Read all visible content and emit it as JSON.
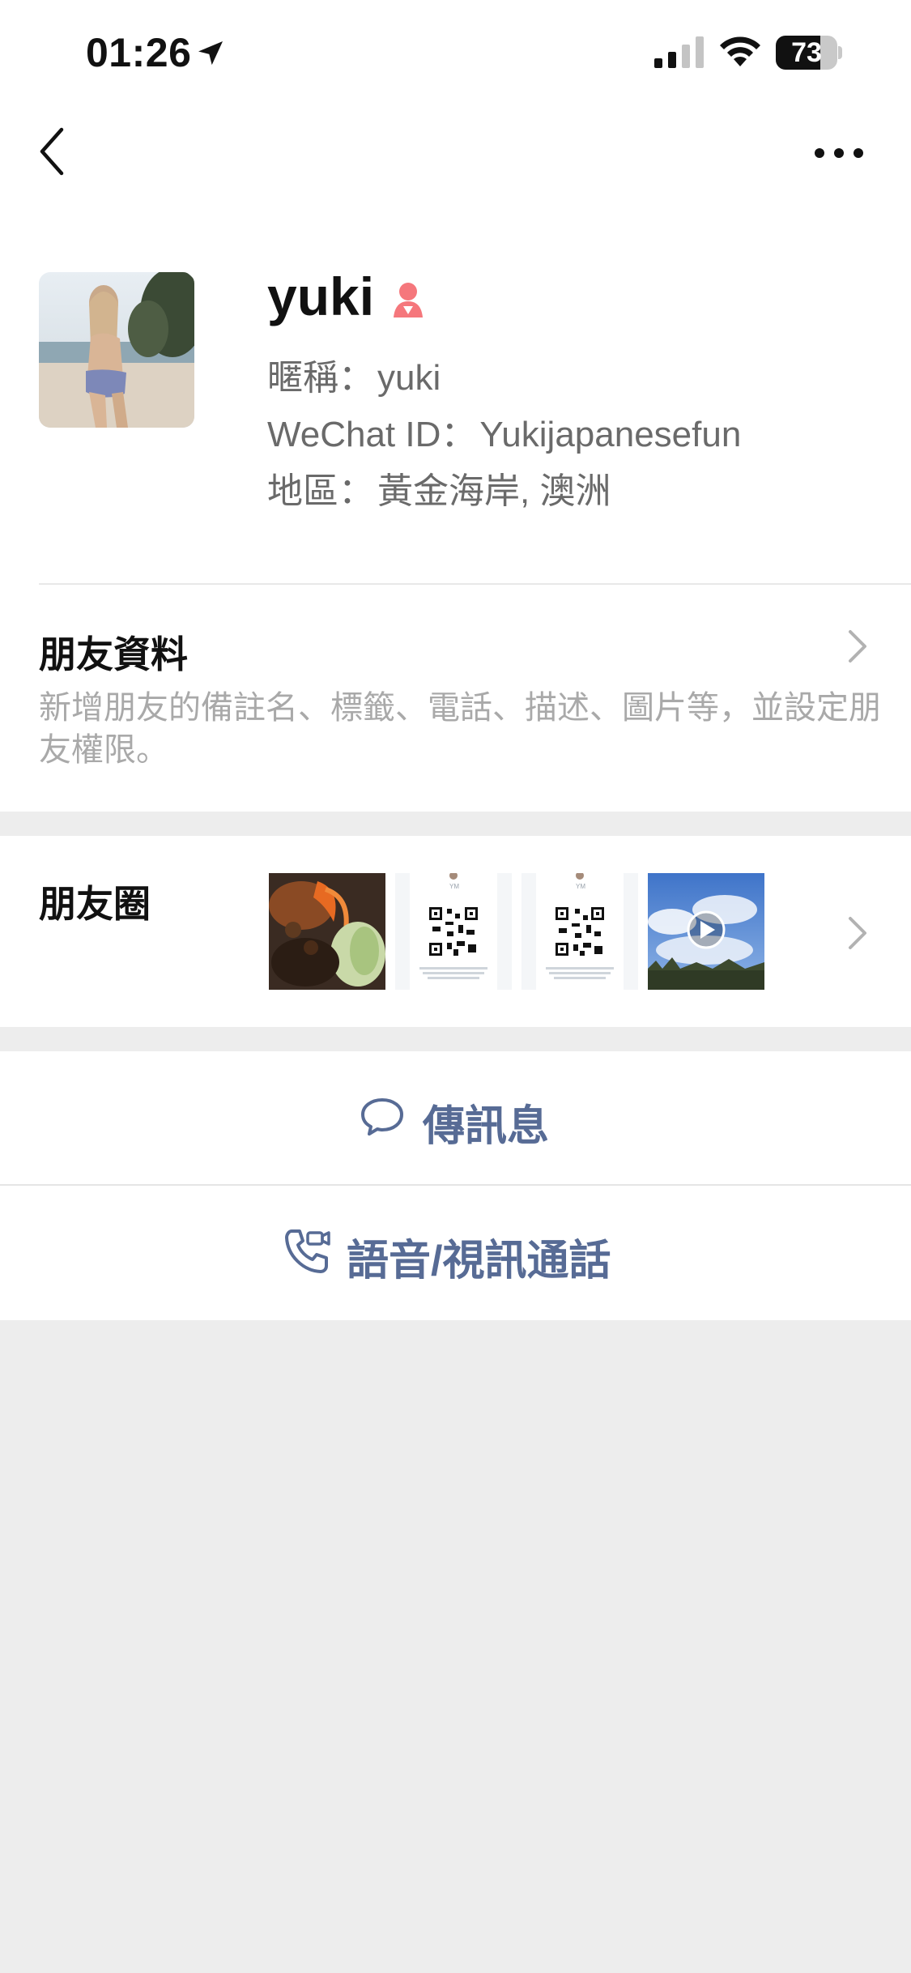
{
  "status_bar": {
    "time": "01:26",
    "battery_percent": 73,
    "battery_text": "73",
    "signal_bars_active": 2,
    "icons": [
      "location-arrow-icon",
      "cell-signal-icon",
      "wifi-icon",
      "battery-icon"
    ]
  },
  "nav": {
    "back_icon": "chevron-left-icon",
    "more_icon": "more-dots-icon"
  },
  "profile": {
    "name": "yuki",
    "gender_icon": "female-icon",
    "gender_color": "#f5777c",
    "nickname_label": "暱稱：",
    "nickname": "yuki",
    "wechat_id_label": "WeChat ID：",
    "wechat_id": "Yukijapanesefun",
    "region_label": "地區：",
    "region": "黃金海岸, 澳洲"
  },
  "friend_info": {
    "title": "朋友資料",
    "description": "新增朋友的備註名、標籤、電話、描述、圖片等，並設定朋友權限。"
  },
  "moments": {
    "title": "朋友圈",
    "thumbnails": [
      {
        "kind": "food-photo"
      },
      {
        "kind": "qr-card",
        "initials": "YM"
      },
      {
        "kind": "qr-card",
        "initials": "YM"
      },
      {
        "kind": "video",
        "icon": "play-icon"
      }
    ]
  },
  "actions": {
    "message_label": "傳訊息",
    "message_icon": "chat-bubble-icon",
    "call_label": "語音/視訊通話",
    "call_icon": "phone-video-icon"
  },
  "colors": {
    "link_blue": "#576b95",
    "background": "#ededed"
  }
}
